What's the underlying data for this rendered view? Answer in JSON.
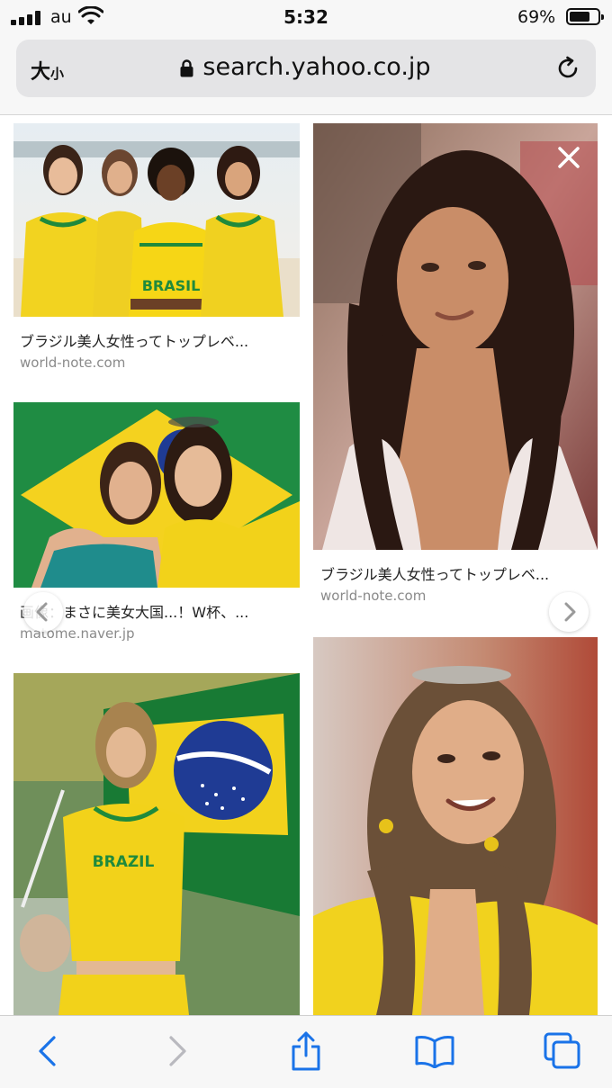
{
  "status": {
    "carrier": "au",
    "time": "5:32",
    "battery_pct": "69%",
    "battery_level": 0.69
  },
  "browser": {
    "text_size_label": "大",
    "text_size_small": "小",
    "url": "search.yahoo.co.jp"
  },
  "results": [
    {
      "caption": "ブラジル美人女性ってトップレベ...",
      "domain": "world-note.com"
    },
    {
      "caption": "ブラジル美人女性ってトップレベ...",
      "domain": "world-note.com"
    },
    {
      "caption": "画像：まさに美女大国...！W杯、...",
      "domain": "matome.naver.jp"
    }
  ],
  "jersey_text": {
    "brasil": "BRASIL",
    "brazil": "BRAZIL"
  },
  "colors": {
    "accent": "#1a73e8",
    "brazil_yellow": "#f4d21f",
    "brazil_green": "#0f8a3c",
    "brazil_blue": "#1f3b94"
  },
  "icons": {
    "back": "chevron-left-icon",
    "forward": "chevron-right-icon",
    "share": "share-icon",
    "bookmarks": "book-icon",
    "tabs": "tabs-icon",
    "close": "close-icon"
  }
}
